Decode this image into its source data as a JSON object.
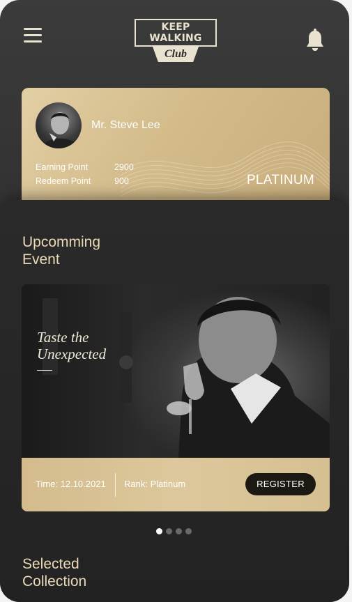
{
  "header": {
    "logo_top": "KEEP WALKING",
    "logo_bottom": "Club",
    "menu_icon": "hamburger-menu-icon",
    "bell_icon": "bell-icon"
  },
  "member": {
    "name": "Mr. Steve Lee",
    "earning_label": "Earning Point",
    "earning_value": "2900",
    "redeem_label": "Redeem Point",
    "redeem_value": "900",
    "tier": "PLATINUM"
  },
  "upcoming": {
    "title_line1": "Upcomming",
    "title_line2": "Event",
    "event": {
      "tagline_line1": "Taste the",
      "tagline_line2": "Unexpected",
      "time": "Time: 12.10.2021",
      "rank": "Rank: Platinum",
      "register_label": "REGISTER"
    },
    "pager": {
      "count": 4,
      "active_index": 0
    }
  },
  "selected": {
    "title_line1": "Selected",
    "title_line2": "Collection"
  },
  "colors": {
    "gold": "#d3bb8a",
    "title_gold": "#e9d9b6",
    "dark_button": "#1c1812"
  }
}
